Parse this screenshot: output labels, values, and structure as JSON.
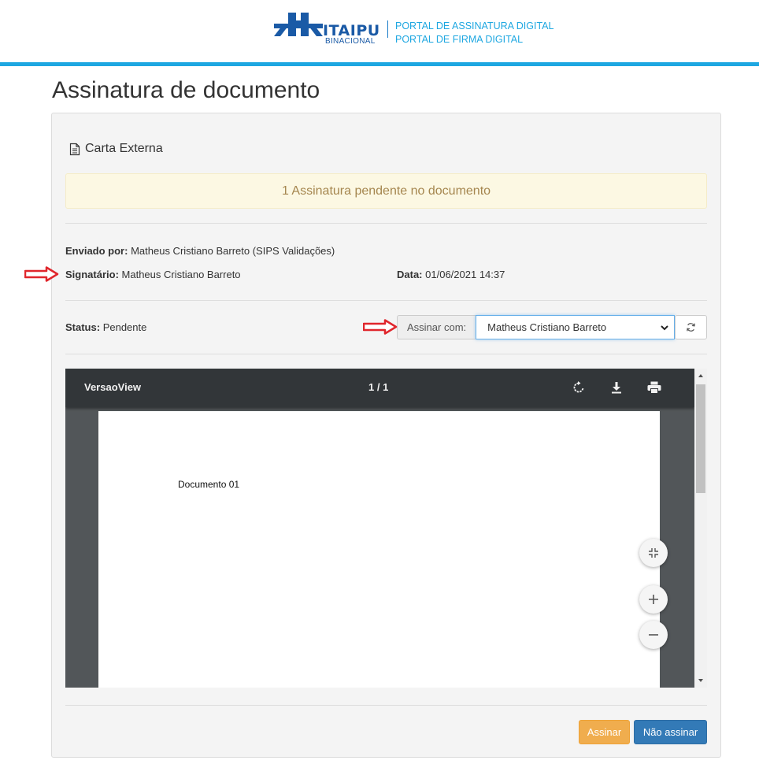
{
  "header": {
    "logo_word": "ITAIPU",
    "logo_sub": "BINACIONAL",
    "portal_line1": "PORTAL DE ASSINATURA DIGITAL",
    "portal_line2": "PORTAL DE FIRMA DIGITAL"
  },
  "page_title": "Assinatura de documento",
  "document": {
    "title": "Carta Externa",
    "icon": "file-text-icon"
  },
  "alert": "1 Assinatura pendente no documento",
  "details": {
    "sent_by_label": "Enviado por:",
    "sent_by_value": "Matheus Cristiano Barreto (SIPS Validações)",
    "signatory_label": "Signatário:",
    "signatory_value": "Matheus Cristiano Barreto",
    "date_label": "Data:",
    "date_value": "01/06/2021 14:37",
    "status_label": "Status:",
    "status_value": "Pendente"
  },
  "sign_with": {
    "label": "Assinar com:",
    "selected": "Matheus Cristiano Barreto"
  },
  "viewer": {
    "title": "VersaoView",
    "pages": "1 / 1",
    "page_text": "Documento 01",
    "toolbar_icons": [
      "rotate-icon",
      "download-icon",
      "print-icon"
    ],
    "fab_icons": [
      "fit-page-icon",
      "zoom-in-icon",
      "zoom-out-icon"
    ]
  },
  "actions": {
    "sign_label": "Assinar",
    "nosign_label": "Não assinar"
  },
  "colors": {
    "accent_bar": "#1ea7e1",
    "brand_blue": "#1a5aa6",
    "alert_bg": "#fcf8e3",
    "alert_text": "#a5864f",
    "sign_button": "#f0ad4e",
    "nosign_button": "#337ab7",
    "annotation_arrow": "#e0262c"
  }
}
